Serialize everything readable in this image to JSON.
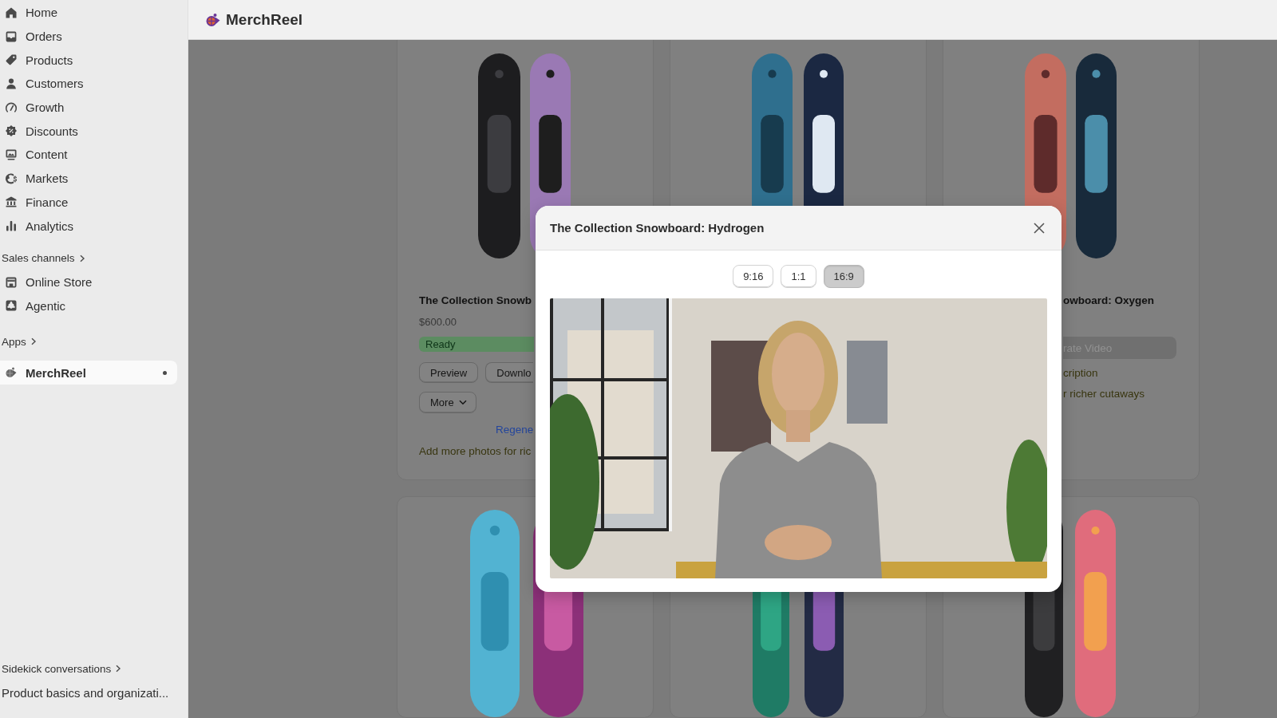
{
  "sidebar": {
    "main_items": [
      {
        "label": "Home",
        "selected": false
      },
      {
        "label": "Orders",
        "selected": false
      },
      {
        "label": "Products",
        "selected": false
      },
      {
        "label": "Customers",
        "selected": false
      },
      {
        "label": "Growth",
        "selected": false
      },
      {
        "label": "Discounts",
        "selected": false
      },
      {
        "label": "Content",
        "selected": false
      },
      {
        "label": "Markets",
        "selected": false
      },
      {
        "label": "Finance",
        "selected": false
      },
      {
        "label": "Analytics",
        "selected": false
      }
    ],
    "sections": [
      {
        "heading": "Sales channels",
        "items": [
          {
            "label": "Online Store",
            "selected": false
          },
          {
            "label": "Agentic",
            "selected": false
          }
        ]
      },
      {
        "heading": "Apps",
        "items": [
          {
            "label": "MerchReel",
            "selected": true,
            "dot": true
          }
        ]
      }
    ],
    "footer": {
      "heading": "Sidekick conversations",
      "items": [
        {
          "label": "Product basics and organizati...",
          "selected": false
        }
      ]
    }
  },
  "top_bar": {
    "title": "MerchReel"
  },
  "products": [
    {
      "kind": "ready",
      "title": "The Collection Snowb",
      "price": "$600.00",
      "status": "Ready",
      "actions": [
        "Preview",
        "Downlo"
      ],
      "more": "More",
      "link": "Regene",
      "note": "Add more photos for ric"
    },
    {
      "kind": "image"
    },
    {
      "kind": "generate",
      "title": "owboard: Oxygen",
      "button": {
        "label": "rate Video",
        "disabled": true
      },
      "notes": [
        "cription",
        "r richer cutaways"
      ]
    },
    {
      "kind": "image"
    },
    {
      "kind": "image"
    },
    {
      "kind": "image"
    }
  ],
  "dialog": {
    "title": "The Collection Snowboard: Hydrogen",
    "aspect_ratios": [
      {
        "label": "9:16",
        "selected": false
      },
      {
        "label": "1:1",
        "selected": false
      },
      {
        "label": "16:9",
        "selected": true
      }
    ]
  }
}
